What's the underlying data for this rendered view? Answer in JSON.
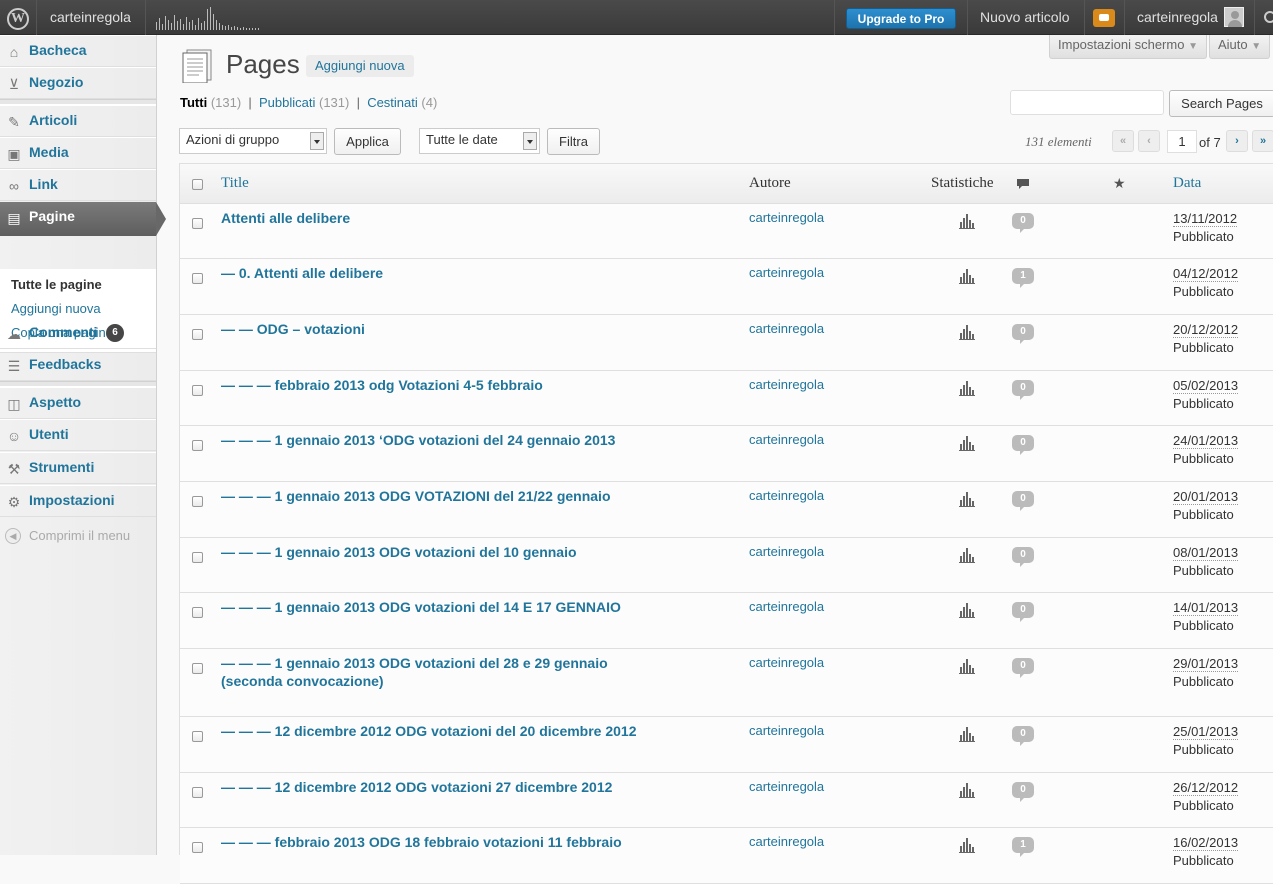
{
  "adminbar": {
    "site_name": "carteinregola",
    "upgrade_label": "Upgrade to Pro",
    "new_post_label": "Nuovo articolo",
    "user_name": "carteinregola"
  },
  "sidebar": {
    "items": [
      {
        "label": "Bacheca",
        "icon": "home-icon"
      },
      {
        "label": "Negozio",
        "icon": "cart-icon"
      },
      {
        "label": "Articoli",
        "icon": "pin-icon"
      },
      {
        "label": "Media",
        "icon": "media-icon"
      },
      {
        "label": "Link",
        "icon": "link-icon"
      },
      {
        "label": "Pagine",
        "icon": "pages-icon"
      },
      {
        "label": "Commenti",
        "icon": "comments-icon"
      },
      {
        "label": "Feedbacks",
        "icon": "feedback-icon"
      },
      {
        "label": "Aspetto",
        "icon": "appearance-icon"
      },
      {
        "label": "Utenti",
        "icon": "users-icon"
      },
      {
        "label": "Strumenti",
        "icon": "tools-icon"
      },
      {
        "label": "Impostazioni",
        "icon": "settings-icon"
      }
    ],
    "submenu": [
      "Tutte le pagine",
      "Aggiungi nuova",
      "Copia una pagina"
    ],
    "comments_badge": "6",
    "collapse_label": "Comprimi il menu"
  },
  "screen_options": {
    "settings_label": "Impostazioni schermo",
    "help_label": "Aiuto"
  },
  "page": {
    "title": "Pages",
    "add_new_label": "Aggiungi nuova",
    "filters": {
      "all_label": "Tutti",
      "all_count": "(131)",
      "published_label": "Pubblicati",
      "published_count": "(131)",
      "trash_label": "Cestinati",
      "trash_count": "(4)"
    },
    "search_button": "Search Pages",
    "bulk_select": "Azioni di gruppo",
    "apply_button": "Applica",
    "date_select": "Tutte le date",
    "filter_button": "Filtra",
    "item_count": "131 elementi",
    "pagination": {
      "first": "«",
      "prev": "‹",
      "current": "1",
      "of_label": "of 7",
      "next": "›",
      "last": "»"
    }
  },
  "table": {
    "headers": {
      "title": "Title",
      "author": "Autore",
      "stats": "Statistiche",
      "date": "Data"
    },
    "rows": [
      {
        "title": "Attenti alle delibere",
        "author": "carteinregola",
        "comments": "0",
        "date": "13/11/2012",
        "status": "Pubblicato"
      },
      {
        "title": "— 0. Attenti alle delibere",
        "author": "carteinregola",
        "comments": "1",
        "date": "04/12/2012",
        "status": "Pubblicato"
      },
      {
        "title": "— — ODG – votazioni",
        "author": "carteinregola",
        "comments": "0",
        "date": "20/12/2012",
        "status": "Pubblicato"
      },
      {
        "title": "— — — febbraio 2013 odg Votazioni 4-5 febbraio",
        "author": "carteinregola",
        "comments": "0",
        "date": "05/02/2013",
        "status": "Pubblicato"
      },
      {
        "title": "— — — 1 gennaio 2013 ‘ODG votazioni del 24 gennaio 2013",
        "author": "carteinregola",
        "comments": "0",
        "date": "24/01/2013",
        "status": "Pubblicato"
      },
      {
        "title": "— — — 1 gennaio 2013 ODG VOTAZIONI del 21/22 gennaio",
        "author": "carteinregola",
        "comments": "0",
        "date": "20/01/2013",
        "status": "Pubblicato"
      },
      {
        "title": "— — — 1 gennaio 2013 ODG votazioni del 10 gennaio",
        "author": "carteinregola",
        "comments": "0",
        "date": "08/01/2013",
        "status": "Pubblicato"
      },
      {
        "title": "— — — 1 gennaio 2013 ODG votazioni del 14 E 17 GENNAIO",
        "author": "carteinregola",
        "comments": "0",
        "date": "14/01/2013",
        "status": "Pubblicato"
      },
      {
        "title": "— — — 1 gennaio 2013 ODG votazioni del 28 e 29 gennaio (seconda convocazione)",
        "author": "carteinregola",
        "comments": "0",
        "date": "29/01/2013",
        "status": "Pubblicato"
      },
      {
        "title": "— — — 12 dicembre 2012 ODG votazioni del 20 dicembre 2012",
        "author": "carteinregola",
        "comments": "0",
        "date": "25/01/2013",
        "status": "Pubblicato"
      },
      {
        "title": "— — — 12 dicembre 2012 ODG votazioni 27 dicembre 2012",
        "author": "carteinregola",
        "comments": "0",
        "date": "26/12/2012",
        "status": "Pubblicato"
      },
      {
        "title": "— — — febbraio 2013 ODG 18 febbraio votazioni 11 febbraio",
        "author": "carteinregola",
        "comments": "1",
        "date": "16/02/2013",
        "status": "Pubblicato"
      }
    ]
  }
}
